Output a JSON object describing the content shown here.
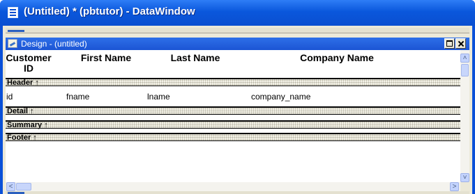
{
  "window": {
    "title": "(Untitled) * (pbtutor) - DataWindow"
  },
  "design_view": {
    "title": "Design - (untitled)"
  },
  "column_headers": [
    {
      "line1": "Customer",
      "line2": "ID"
    },
    {
      "line1": "First Name"
    },
    {
      "line1": "Last Name"
    },
    {
      "line1": "Company Name"
    }
  ],
  "bands": [
    {
      "label": "Header ↑"
    },
    {
      "label": "Detail ↑"
    },
    {
      "label": "Summary ↑"
    },
    {
      "label": "Footer ↑"
    }
  ],
  "detail_fields": [
    "id",
    "fname",
    "lname",
    "company_name"
  ],
  "colors": {
    "titlebar": "#0a57dc",
    "inner_titlebar": "#1c55d4",
    "canvas": "#ffffff",
    "chrome": "#ece9d8",
    "scrollbar_button": "#c3d3fd"
  },
  "icons": {
    "window": "datawindow-icon",
    "design": "design-painter-icon",
    "maximize": "maximize-icon",
    "close": "close-icon",
    "scroll_up": "chevron-up-icon",
    "scroll_down": "chevron-down-icon",
    "scroll_left": "chevron-left-icon",
    "scroll_right": "chevron-right-icon"
  }
}
